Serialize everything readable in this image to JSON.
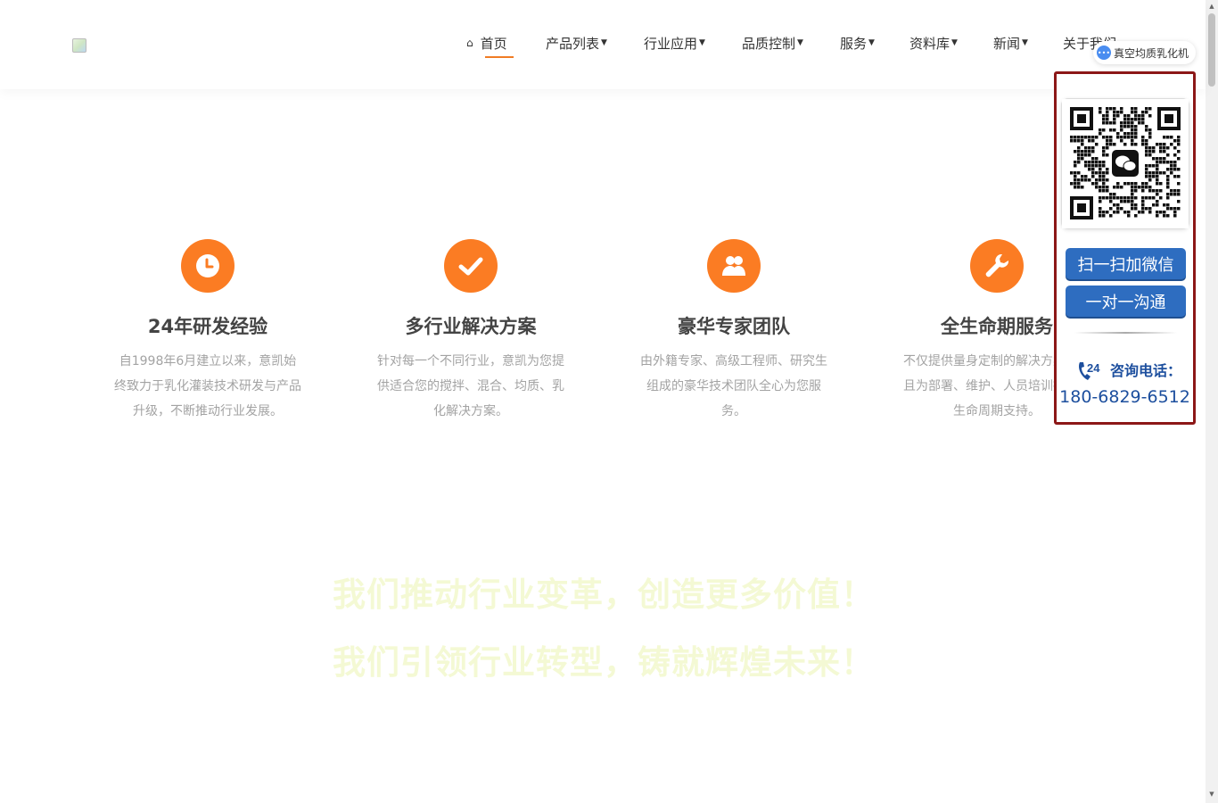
{
  "nav": {
    "home": "首页",
    "items": [
      {
        "label": "产品列表"
      },
      {
        "label": "行业应用"
      },
      {
        "label": "品质控制"
      },
      {
        "label": "服务"
      },
      {
        "label": "资料库"
      },
      {
        "label": "新闻"
      },
      {
        "label": "关于我们"
      }
    ]
  },
  "features": [
    {
      "icon": "clock-icon",
      "title": "24年研发经验",
      "desc": "自1998年6月建立以来，意凯始终致力于乳化灌装技术研发与产品升级，不断推动行业发展。"
    },
    {
      "icon": "check-icon",
      "title": "多行业解决方案",
      "desc": "针对每一个不同行业，意凯为您提供适合您的搅拌、混合、均质、乳化解决方案。"
    },
    {
      "icon": "team-icon",
      "title": "豪华专家团队",
      "desc": "由外籍专家、高级工程师、研究生组成的豪华技术团队全心为您服务。"
    },
    {
      "icon": "wrench-icon",
      "title": "全生命期服务",
      "desc": "不仅提供量身定制的解决方案，而且为部署、维护、人员培训提供全生命周期支持。"
    }
  ],
  "slogans": [
    "我们推动行业变革，创造更多价值！",
    "我们引领行业转型，铸就辉煌未来！"
  ],
  "float_panel": {
    "scan_button": "扫一扫加微信",
    "talk_button": "一对一沟通",
    "phone_label": "咨询电话：",
    "phone_number": "180-6829-6512",
    "hotline_badge": "24"
  },
  "chat_badge": "真空均质乳化机",
  "colors": {
    "accent": "#fb7c23",
    "panel_border": "#8c1717",
    "button_blue": "#2e6dc0",
    "phone_blue": "#1d4f9e",
    "slogan": "#f4f9d4"
  }
}
